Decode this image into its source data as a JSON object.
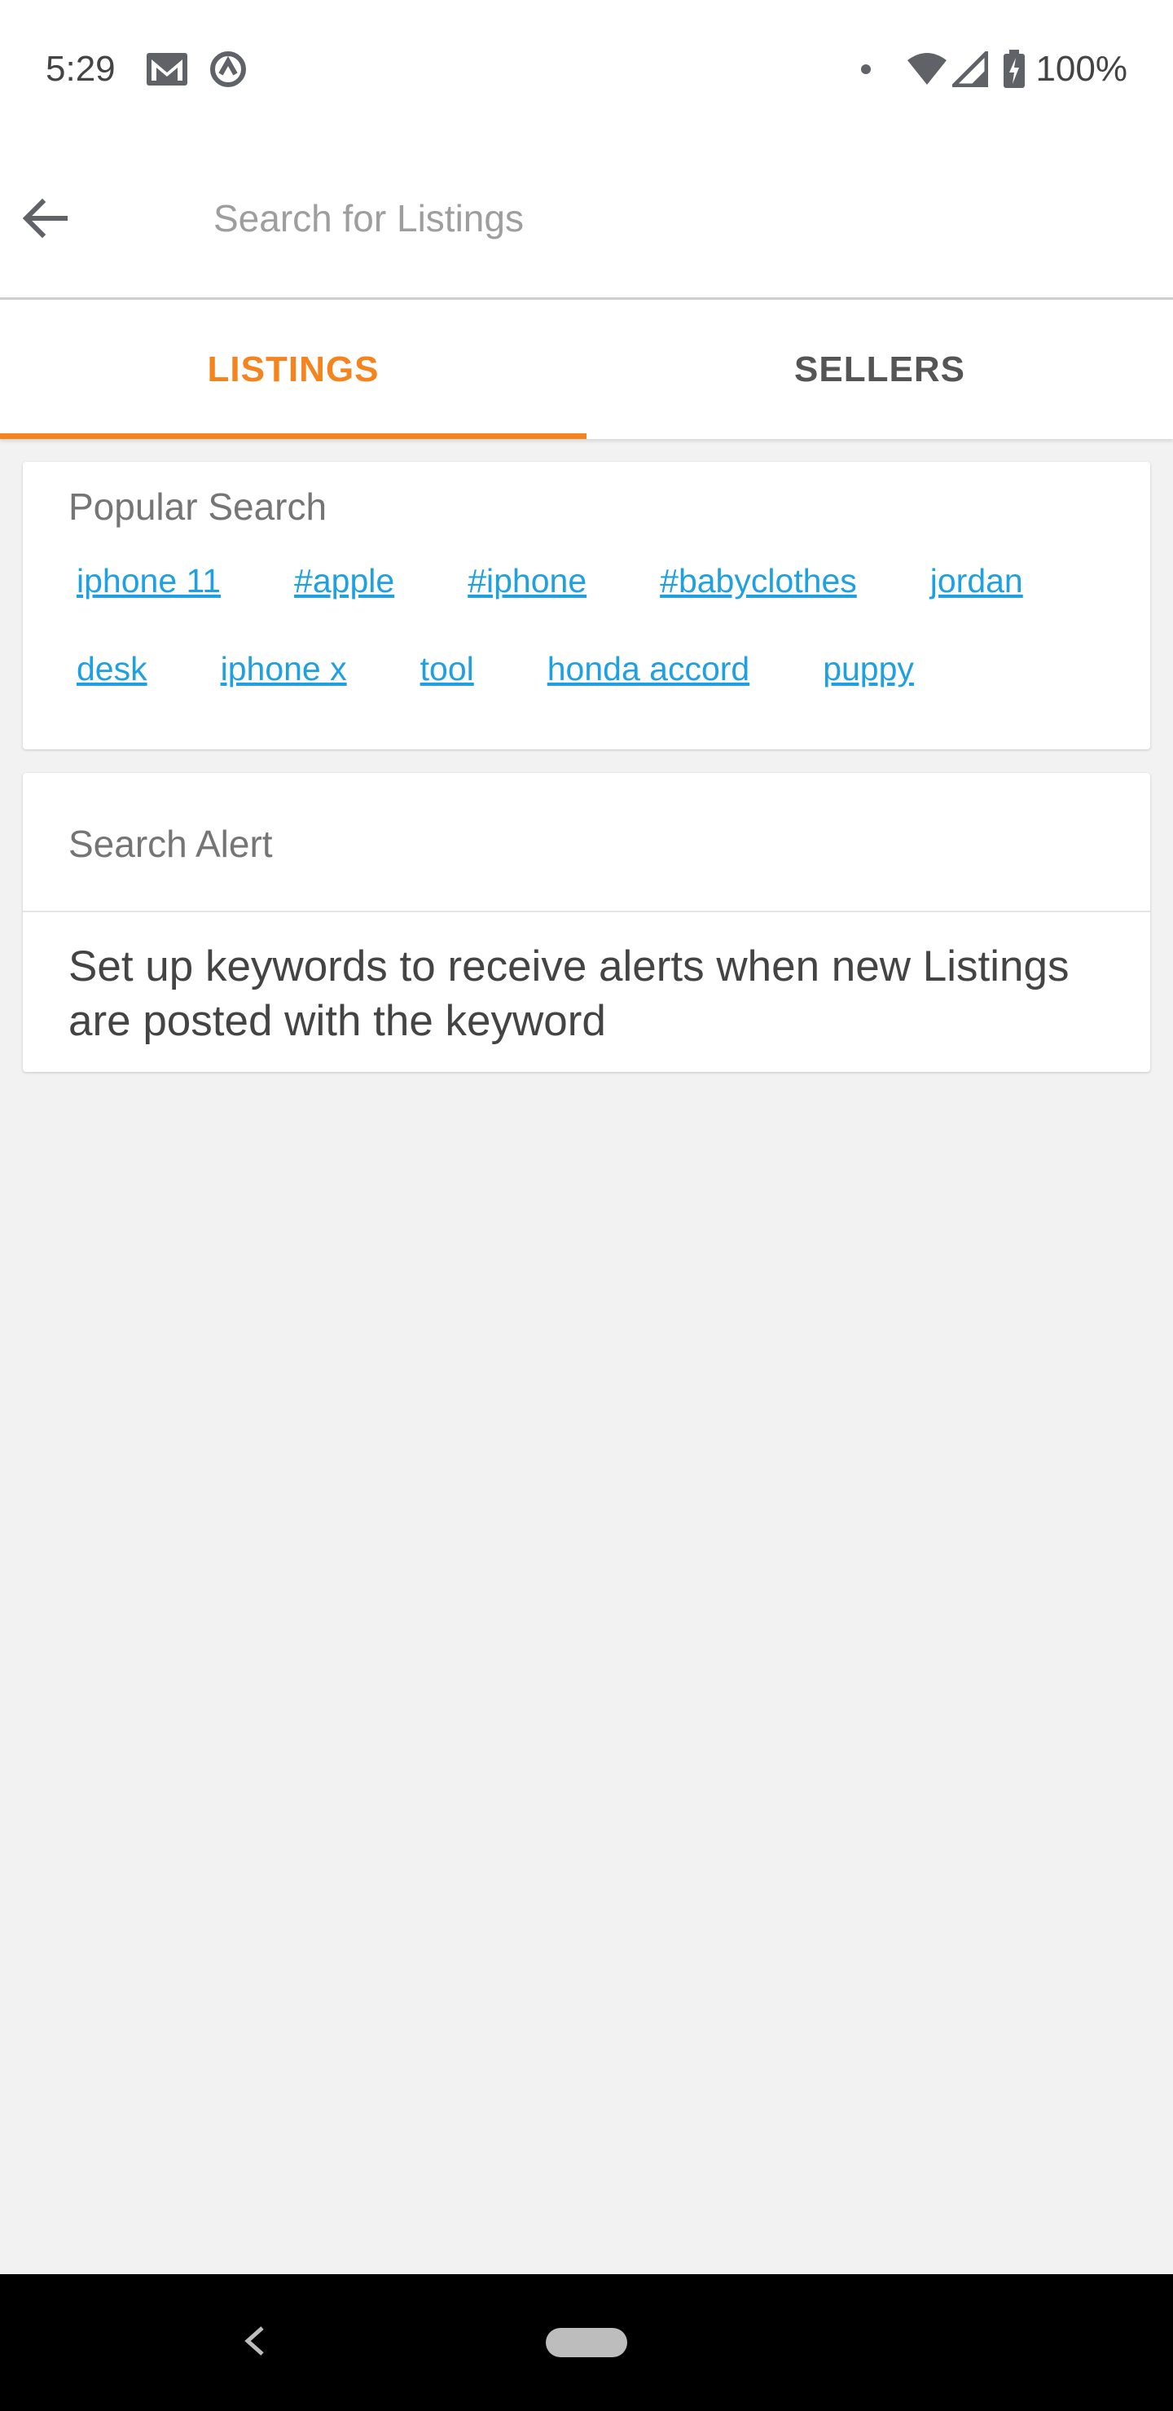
{
  "status_bar": {
    "time": "5:29",
    "battery": "100%",
    "icons": [
      "gmail-icon",
      "sync-icon",
      "dot-icon",
      "wifi-icon",
      "signal-icon",
      "battery-charging-icon"
    ]
  },
  "search": {
    "placeholder": "Search for Listings",
    "value": ""
  },
  "tabs": [
    {
      "label": "LISTINGS",
      "active": true
    },
    {
      "label": "SELLERS",
      "active": false
    }
  ],
  "popular_search": {
    "title": "Popular Search",
    "tags": [
      "iphone 11",
      "#apple",
      "#iphone",
      "#babyclothes",
      "jordan",
      "desk",
      "iphone x",
      "tool",
      "honda accord",
      "puppy"
    ]
  },
  "search_alert": {
    "title": "Search Alert",
    "description": "Set up keywords to receive alerts when new Listings are posted with the keyword"
  },
  "colors": {
    "accent": "#f5841f",
    "link": "#1fa0e0",
    "background": "#f2f2f2"
  }
}
